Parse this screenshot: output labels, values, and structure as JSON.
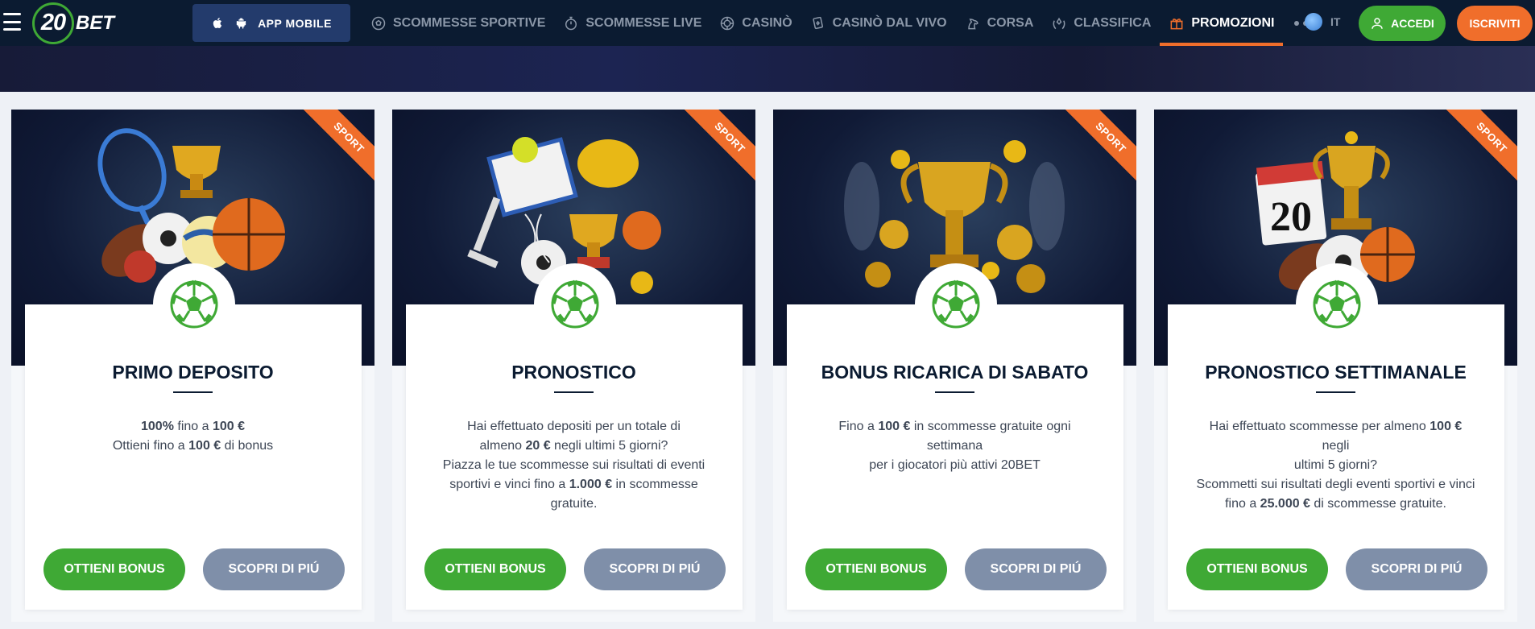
{
  "header": {
    "brand_number": "20",
    "brand_name": "BET",
    "app_button": "APP MOBILE",
    "nav": [
      {
        "label": "SCOMMESSE SPORTIVE",
        "icon": "soccer-ball-icon"
      },
      {
        "label": "SCOMMESSE LIVE",
        "icon": "live-stopwatch-icon"
      },
      {
        "label": "CASINÒ",
        "icon": "casino-chip-icon"
      },
      {
        "label": "CASINÒ DAL VIVO",
        "icon": "playing-card-icon"
      },
      {
        "label": "CORSA",
        "icon": "horse-icon"
      },
      {
        "label": "CLASSIFICA",
        "icon": "laurel-icon"
      },
      {
        "label": "PROMOZIONI",
        "icon": "gift-icon",
        "active": true
      }
    ],
    "language": "IT",
    "login_button": "ACCEDI",
    "signup_button": "ISCRIVITI"
  },
  "colors": {
    "header_bg": "#0b1b31",
    "accent_orange": "#f06e2b",
    "accent_green": "#3fa935",
    "secondary_button": "#7f8fa9"
  },
  "promotions": [
    {
      "tag": "SPORT",
      "title": "PRIMO DEPOSITO",
      "description_lines": [
        "100% fino a 100 €",
        "Ottieni fino a 100 € di bonus"
      ],
      "bonus_button": "OTTIENI BONUS",
      "more_button": "SCOPRI DI PIÚ"
    },
    {
      "tag": "SPORT",
      "title": "PRONOSTICO",
      "description_lines": [
        "Hai effettuato depositi per un totale di",
        "almeno 20 € negli ultimi 5 giorni?",
        "Piazza le tue scommesse sui risultati di eventi",
        "sportivi e vinci fino a 1.000 € in scommesse",
        "gratuite."
      ],
      "bonus_button": "OTTIENI BONUS",
      "more_button": "SCOPRI DI PIÚ"
    },
    {
      "tag": "SPORT",
      "title": "BONUS RICARICA DI SABATO",
      "description_lines": [
        "Fino a 100 € in scommesse gratuite ogni settimana",
        "per i giocatori più attivi 20BET"
      ],
      "bonus_button": "OTTIENI BONUS",
      "more_button": "SCOPRI DI PIÚ"
    },
    {
      "tag": "SPORT",
      "title": "PRONOSTICO SETTIMANALE",
      "calendar_number": "20",
      "description_lines": [
        "Hai effettuato scommesse per almeno 100 € negli",
        "ultimi 5 giorni?",
        "Scommetti sui risultati degli eventi sportivi e vinci",
        "fino a 25.000 € di scommesse gratuite."
      ],
      "bonus_button": "OTTIENI BONUS",
      "more_button": "SCOPRI DI PIÚ"
    }
  ]
}
